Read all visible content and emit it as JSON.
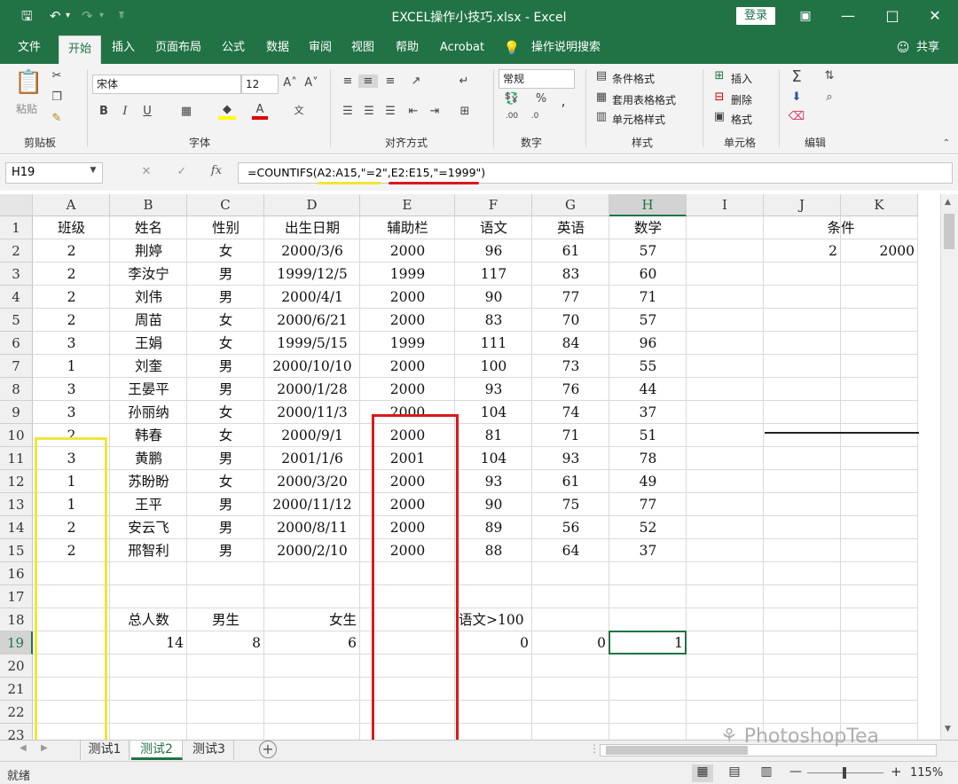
{
  "window": {
    "title": "EXCEL操作小技巧.xlsx  -  Excel",
    "login_label": "登录"
  },
  "ribbon_tabs": [
    "文件",
    "开始",
    "插入",
    "页面布局",
    "公式",
    "数据",
    "审阅",
    "视图",
    "帮助",
    "Acrobat",
    "操作说明搜索"
  ],
  "share_label": "共享",
  "ribbon": {
    "paste_label": "粘贴",
    "font_name": "宋体",
    "font_size": "12",
    "number_format": "常规",
    "conditional_format": "条件格式",
    "table_format": "套用表格格式",
    "cell_style": "单元格样式",
    "insert": "插入",
    "delete": "删除",
    "format": "格式",
    "groups": [
      "剪贴板",
      "字体",
      "对齐方式",
      "数字",
      "样式",
      "单元格",
      "编辑"
    ]
  },
  "formula_bar": {
    "name_box": "H19",
    "fx": "fx",
    "formula": "=COUNTIFS(A2:A15,\"=2\",E2:E15,\"=1999\")"
  },
  "columns": [
    "A",
    "B",
    "C",
    "D",
    "E",
    "F",
    "G",
    "H",
    "I",
    "J",
    "K"
  ],
  "rows": [
    [
      "班级",
      "姓名",
      "性别",
      "出生日期",
      "辅助栏",
      "语文",
      "英语",
      "数学",
      "",
      "条件",
      ""
    ],
    [
      "2",
      "荆婷",
      "女",
      "2000/3/6",
      "2000",
      "96",
      "61",
      "57",
      "",
      "2",
      "2000"
    ],
    [
      "2",
      "李汝宁",
      "男",
      "1999/12/5",
      "1999",
      "117",
      "83",
      "60",
      "",
      "",
      ""
    ],
    [
      "2",
      "刘伟",
      "男",
      "2000/4/1",
      "2000",
      "90",
      "77",
      "71",
      "",
      "",
      ""
    ],
    [
      "2",
      "周苗",
      "女",
      "2000/6/21",
      "2000",
      "83",
      "70",
      "57",
      "",
      "",
      ""
    ],
    [
      "3",
      "王娟",
      "女",
      "1999/5/15",
      "1999",
      "111",
      "84",
      "96",
      "",
      "",
      ""
    ],
    [
      "1",
      "刘奎",
      "男",
      "2000/10/10",
      "2000",
      "100",
      "73",
      "55",
      "",
      "",
      ""
    ],
    [
      "3",
      "王晏平",
      "男",
      "2000/1/28",
      "2000",
      "93",
      "76",
      "44",
      "",
      "",
      ""
    ],
    [
      "3",
      "孙丽纳",
      "女",
      "2000/11/3",
      "2000",
      "104",
      "74",
      "37",
      "",
      "",
      ""
    ],
    [
      "2",
      "韩春",
      "女",
      "2000/9/1",
      "2000",
      "81",
      "71",
      "51",
      "",
      "",
      ""
    ],
    [
      "3",
      "黄鹏",
      "男",
      "2001/1/6",
      "2001",
      "104",
      "93",
      "78",
      "",
      "",
      ""
    ],
    [
      "1",
      "苏盼盼",
      "女",
      "2000/3/20",
      "2000",
      "93",
      "61",
      "49",
      "",
      "",
      ""
    ],
    [
      "1",
      "王平",
      "男",
      "2000/11/12",
      "2000",
      "90",
      "75",
      "77",
      "",
      "",
      ""
    ],
    [
      "2",
      "安云飞",
      "男",
      "2000/8/11",
      "2000",
      "89",
      "56",
      "52",
      "",
      "",
      ""
    ],
    [
      "2",
      "邢智利",
      "男",
      "2000/2/10",
      "2000",
      "88",
      "64",
      "37",
      "",
      "",
      ""
    ],
    [
      "",
      "",
      "",
      "",
      "",
      "",
      "",
      "",
      "",
      "",
      ""
    ],
    [
      "",
      "",
      "",
      "",
      "",
      "",
      "",
      "",
      "",
      "",
      ""
    ],
    [
      "",
      "总人数",
      "男生",
      "女生",
      "",
      "语文>100",
      "",
      "",
      "",
      "",
      ""
    ],
    [
      "",
      "14",
      "8",
      "6",
      "",
      "0",
      "0",
      "1",
      "",
      "",
      ""
    ],
    [
      "",
      "",
      "",
      "",
      "",
      "",
      "",
      "",
      "",
      "",
      ""
    ],
    [
      "",
      "",
      "",
      "",
      "",
      "",
      "",
      "",
      "",
      "",
      ""
    ],
    [
      "",
      "",
      "",
      "",
      "",
      "",
      "",
      "",
      "",
      "",
      ""
    ],
    [
      "",
      "",
      "",
      "",
      "",
      "",
      "",
      "",
      "",
      "",
      ""
    ]
  ],
  "sheets": [
    "测试1",
    "测试2",
    "测试3"
  ],
  "active_sheet": "测试2",
  "status": {
    "ready": "就绪",
    "zoom": "115%"
  },
  "watermark": "PhotoshopTea",
  "colors": {
    "accent": "#217346",
    "highlight_yellow": "#f0e63a",
    "highlight_red": "#d9191b"
  }
}
